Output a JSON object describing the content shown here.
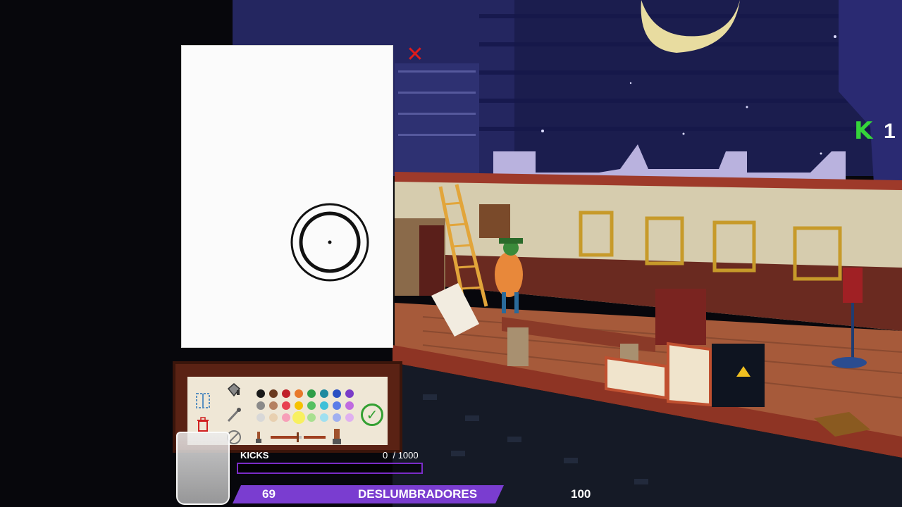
{
  "hud": {
    "kicks_label": "KICKS",
    "kicks_current": "0",
    "kicks_max": "/ 1000",
    "kicks_progress": 0,
    "rank_level": "69",
    "rank_name": "DESLUMBRADORES",
    "rank_next": "100",
    "k_count": "1",
    "k_icon": "k-logo-icon"
  },
  "canvas": {
    "close_icon": "close-icon"
  },
  "palette": {
    "tools": [
      "select-area-icon",
      "trash-icon",
      "bucket-icon",
      "brush-icon",
      "eraser-icon"
    ],
    "colors": [
      "#1a1a1a",
      "#6b3a1e",
      "#c0202a",
      "#e8782a",
      "#2e9e48",
      "#1e8aa0",
      "#2a4fc2",
      "#7a3cc8",
      "#8a8a8a",
      "#b58060",
      "#e84050",
      "#f6c200",
      "#54c060",
      "#3fc0d8",
      "#5a7de8",
      "#c06ae0",
      "#d8d8d8",
      "#e8d0b0",
      "#f7a0b8",
      "#f8f060",
      "#a8e090",
      "#a0e0f0",
      "#a0b0f0",
      "#e0b0f0"
    ],
    "confirm_icon": "checkmark-icon"
  },
  "colors": {
    "accent_purple": "#7a3dd0",
    "kicks_green": "#35d43a"
  }
}
